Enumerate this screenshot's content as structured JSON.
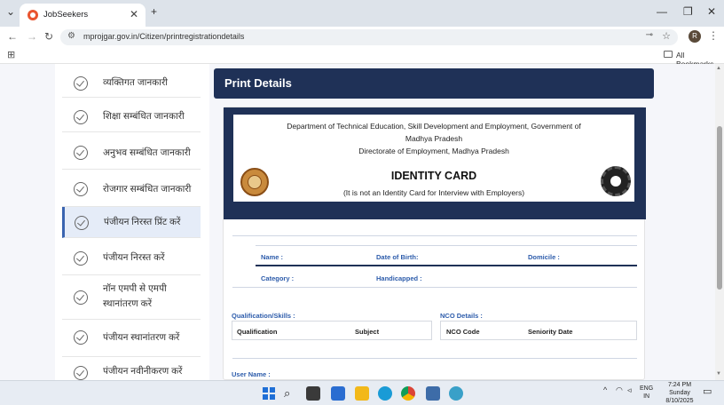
{
  "browser": {
    "tab_title": "JobSeekers",
    "tab_close": "✕",
    "new_tab": "+",
    "url": "mprojgar.gov.in/Citizen/printregistrationdetails",
    "bookmarks_label": "All Bookmarks",
    "avatar_letter": "R",
    "window_controls": [
      "—",
      "❐",
      "✕"
    ]
  },
  "sidebar": {
    "items": [
      {
        "label": "व्यक्तिगत जानकारी"
      },
      {
        "label": "शिक्षा सम्बंधित जानकारी"
      },
      {
        "label": "अनुभव सम्बंधित जानकारी"
      },
      {
        "label": "रोजगार सम्बंधित जानकारी"
      },
      {
        "label": "पंजीयन निरस्त प्रिंट करें"
      },
      {
        "label": "पंजीयन निरस्त करें"
      },
      {
        "label": "नॉन एमपी से एमपी"
      },
      {
        "label": "स्थानांतरण करें"
      },
      {
        "label": "पंजीयन स्थानांतरण करें"
      },
      {
        "label": "पंजीयन नवीनीकरण करें"
      }
    ]
  },
  "main": {
    "title": "Print Details",
    "id_card": {
      "line1": "Department of Technical Education, Skill Development and Employment, Government of",
      "line2": "Madhya Pradesh",
      "line3": "Directorate of Employment, Madhya Pradesh",
      "title": "IDENTITY CARD",
      "subtitle": "(It is not an Identity Card for Interview with Employers)"
    },
    "fields": {
      "name": "Name :",
      "dob": "Date of Birth:",
      "domicile": "Domicile :",
      "category": "Category :",
      "handicapped": "Handicapped :"
    },
    "qualification": {
      "heading": "Qualification/Skills :",
      "columns": [
        "Qualification",
        "Subject"
      ]
    },
    "nco": {
      "heading": "NCO Details :",
      "columns": [
        "NCO Code",
        "Seniority Date"
      ]
    },
    "username_label": "User Name :"
  },
  "taskbar": {
    "lang_top": "ENG",
    "lang_bottom": "IN",
    "time": "7:24 PM",
    "day": "Sunday",
    "date": "8/10/2025"
  }
}
